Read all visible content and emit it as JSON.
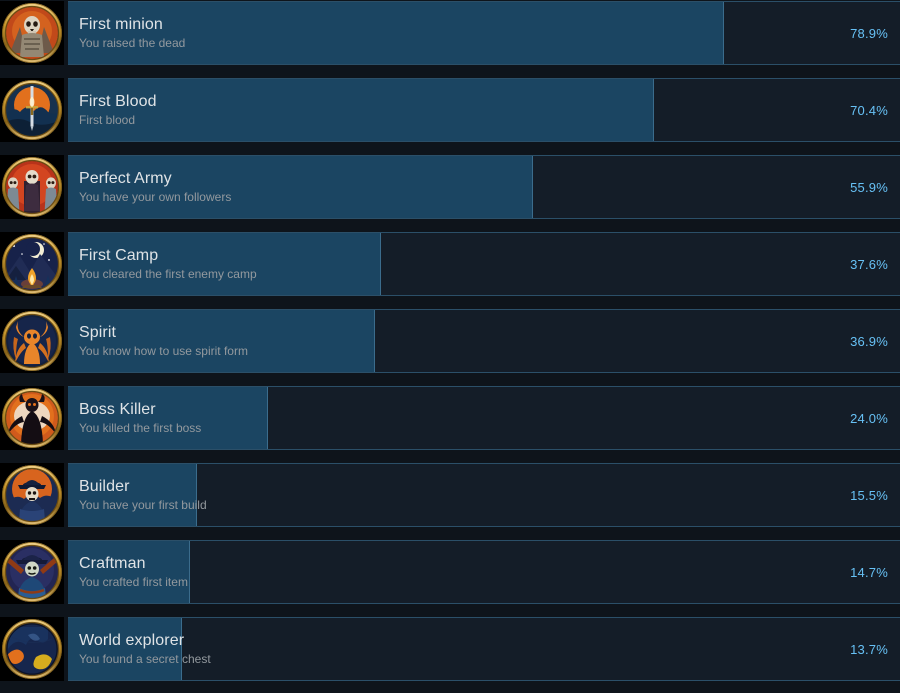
{
  "page": {
    "title": "Steam Global Achievement Stats",
    "background_color": "#0e141b",
    "bar_fill_color": "#1b4562",
    "bar_track_color": "#141d28",
    "percent_color": "#67c1f5",
    "title_color": "#dfe3e6",
    "description_color": "#93999e"
  },
  "achievements": [
    {
      "name": "First minion",
      "description": "You raised the dead",
      "percent_label": "78.9%",
      "percent_value": 78.9,
      "icon": "skeleton-warrior-icon"
    },
    {
      "name": "First Blood",
      "description": "First blood",
      "percent_label": "70.4%",
      "percent_value": 70.4,
      "icon": "sword-sunset-icon"
    },
    {
      "name": "Perfect Army",
      "description": "You have your own followers",
      "percent_label": "55.9%",
      "percent_value": 55.9,
      "icon": "skeleton-army-icon"
    },
    {
      "name": "First Camp",
      "description": "You cleared the first enemy camp",
      "percent_label": "37.6%",
      "percent_value": 37.6,
      "icon": "campfire-night-icon"
    },
    {
      "name": "Spirit",
      "description": "You know how to use spirit form",
      "percent_label": "36.9%",
      "percent_value": 36.9,
      "icon": "horned-spirit-icon"
    },
    {
      "name": "Boss Killer",
      "description": "You killed the first boss",
      "percent_label": "24.0%",
      "percent_value": 24.0,
      "icon": "demon-boss-icon"
    },
    {
      "name": "Builder",
      "description": "You have your first build",
      "percent_label": "15.5%",
      "percent_value": 15.5,
      "icon": "builder-figure-icon"
    },
    {
      "name": "Craftman",
      "description": "You crafted first item",
      "percent_label": "14.7%",
      "percent_value": 14.7,
      "icon": "craftsman-figure-icon"
    },
    {
      "name": "World explorer",
      "description": "You found a secret chest",
      "percent_label": "13.7%",
      "percent_value": 13.7,
      "icon": "world-globe-icon"
    }
  ]
}
